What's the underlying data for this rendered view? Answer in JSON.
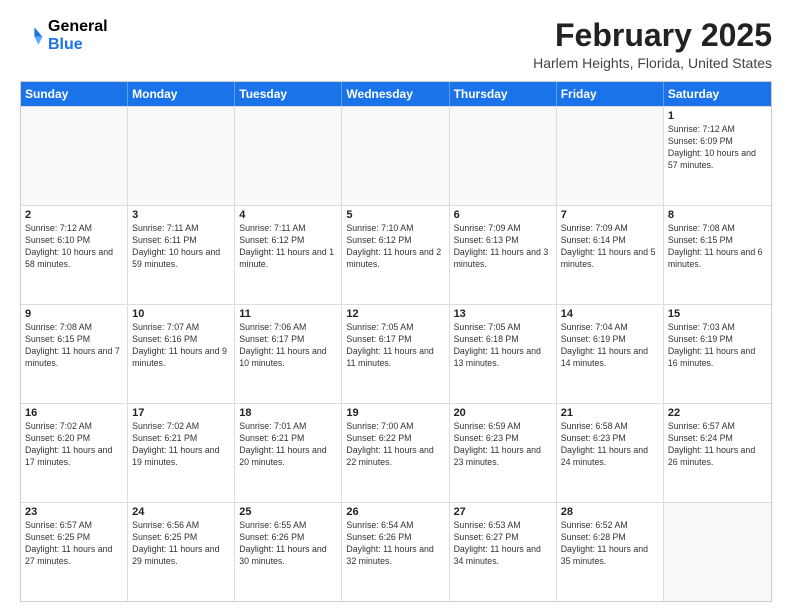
{
  "header": {
    "logo_line1": "General",
    "logo_line2": "Blue",
    "month_title": "February 2025",
    "location": "Harlem Heights, Florida, United States"
  },
  "days_of_week": [
    "Sunday",
    "Monday",
    "Tuesday",
    "Wednesday",
    "Thursday",
    "Friday",
    "Saturday"
  ],
  "weeks": [
    [
      {
        "day": "",
        "info": ""
      },
      {
        "day": "",
        "info": ""
      },
      {
        "day": "",
        "info": ""
      },
      {
        "day": "",
        "info": ""
      },
      {
        "day": "",
        "info": ""
      },
      {
        "day": "",
        "info": ""
      },
      {
        "day": "1",
        "info": "Sunrise: 7:12 AM\nSunset: 6:09 PM\nDaylight: 10 hours\nand 57 minutes."
      }
    ],
    [
      {
        "day": "2",
        "info": "Sunrise: 7:12 AM\nSunset: 6:10 PM\nDaylight: 10 hours\nand 58 minutes."
      },
      {
        "day": "3",
        "info": "Sunrise: 7:11 AM\nSunset: 6:11 PM\nDaylight: 10 hours\nand 59 minutes."
      },
      {
        "day": "4",
        "info": "Sunrise: 7:11 AM\nSunset: 6:12 PM\nDaylight: 11 hours\nand 1 minute."
      },
      {
        "day": "5",
        "info": "Sunrise: 7:10 AM\nSunset: 6:12 PM\nDaylight: 11 hours\nand 2 minutes."
      },
      {
        "day": "6",
        "info": "Sunrise: 7:09 AM\nSunset: 6:13 PM\nDaylight: 11 hours\nand 3 minutes."
      },
      {
        "day": "7",
        "info": "Sunrise: 7:09 AM\nSunset: 6:14 PM\nDaylight: 11 hours\nand 5 minutes."
      },
      {
        "day": "8",
        "info": "Sunrise: 7:08 AM\nSunset: 6:15 PM\nDaylight: 11 hours\nand 6 minutes."
      }
    ],
    [
      {
        "day": "9",
        "info": "Sunrise: 7:08 AM\nSunset: 6:15 PM\nDaylight: 11 hours\nand 7 minutes."
      },
      {
        "day": "10",
        "info": "Sunrise: 7:07 AM\nSunset: 6:16 PM\nDaylight: 11 hours\nand 9 minutes."
      },
      {
        "day": "11",
        "info": "Sunrise: 7:06 AM\nSunset: 6:17 PM\nDaylight: 11 hours\nand 10 minutes."
      },
      {
        "day": "12",
        "info": "Sunrise: 7:05 AM\nSunset: 6:17 PM\nDaylight: 11 hours\nand 11 minutes."
      },
      {
        "day": "13",
        "info": "Sunrise: 7:05 AM\nSunset: 6:18 PM\nDaylight: 11 hours\nand 13 minutes."
      },
      {
        "day": "14",
        "info": "Sunrise: 7:04 AM\nSunset: 6:19 PM\nDaylight: 11 hours\nand 14 minutes."
      },
      {
        "day": "15",
        "info": "Sunrise: 7:03 AM\nSunset: 6:19 PM\nDaylight: 11 hours\nand 16 minutes."
      }
    ],
    [
      {
        "day": "16",
        "info": "Sunrise: 7:02 AM\nSunset: 6:20 PM\nDaylight: 11 hours\nand 17 minutes."
      },
      {
        "day": "17",
        "info": "Sunrise: 7:02 AM\nSunset: 6:21 PM\nDaylight: 11 hours\nand 19 minutes."
      },
      {
        "day": "18",
        "info": "Sunrise: 7:01 AM\nSunset: 6:21 PM\nDaylight: 11 hours\nand 20 minutes."
      },
      {
        "day": "19",
        "info": "Sunrise: 7:00 AM\nSunset: 6:22 PM\nDaylight: 11 hours\nand 22 minutes."
      },
      {
        "day": "20",
        "info": "Sunrise: 6:59 AM\nSunset: 6:23 PM\nDaylight: 11 hours\nand 23 minutes."
      },
      {
        "day": "21",
        "info": "Sunrise: 6:58 AM\nSunset: 6:23 PM\nDaylight: 11 hours\nand 24 minutes."
      },
      {
        "day": "22",
        "info": "Sunrise: 6:57 AM\nSunset: 6:24 PM\nDaylight: 11 hours\nand 26 minutes."
      }
    ],
    [
      {
        "day": "23",
        "info": "Sunrise: 6:57 AM\nSunset: 6:25 PM\nDaylight: 11 hours\nand 27 minutes."
      },
      {
        "day": "24",
        "info": "Sunrise: 6:56 AM\nSunset: 6:25 PM\nDaylight: 11 hours\nand 29 minutes."
      },
      {
        "day": "25",
        "info": "Sunrise: 6:55 AM\nSunset: 6:26 PM\nDaylight: 11 hours\nand 30 minutes."
      },
      {
        "day": "26",
        "info": "Sunrise: 6:54 AM\nSunset: 6:26 PM\nDaylight: 11 hours\nand 32 minutes."
      },
      {
        "day": "27",
        "info": "Sunrise: 6:53 AM\nSunset: 6:27 PM\nDaylight: 11 hours\nand 34 minutes."
      },
      {
        "day": "28",
        "info": "Sunrise: 6:52 AM\nSunset: 6:28 PM\nDaylight: 11 hours\nand 35 minutes."
      },
      {
        "day": "",
        "info": ""
      }
    ]
  ]
}
